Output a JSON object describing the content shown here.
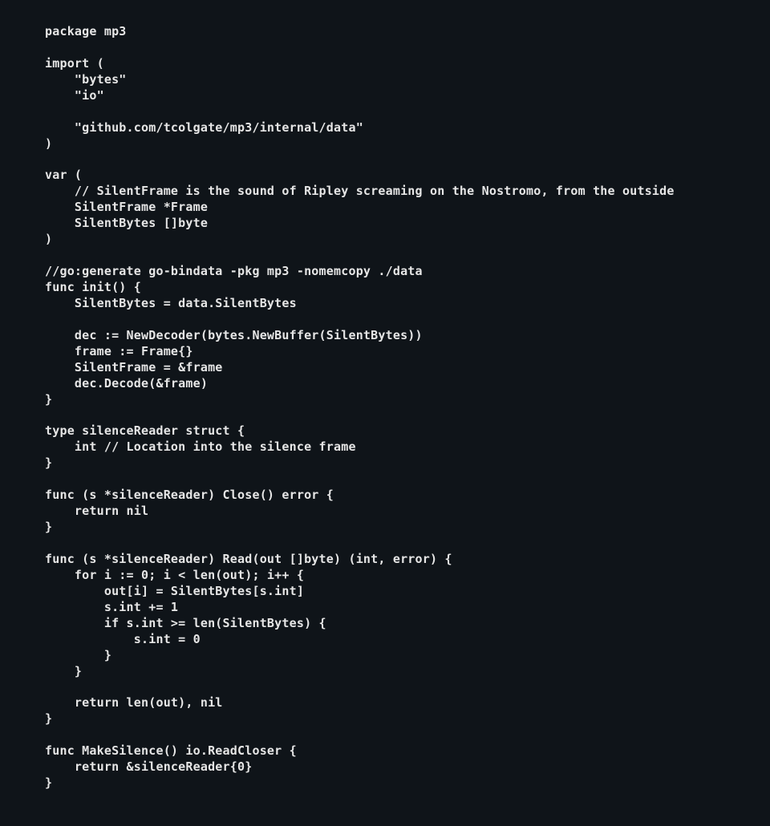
{
  "code": "package mp3\n\nimport (\n    \"bytes\"\n    \"io\"\n\n    \"github.com/tcolgate/mp3/internal/data\"\n)\n\nvar (\n    // SilentFrame is the sound of Ripley screaming on the Nostromo, from the outside\n    SilentFrame *Frame\n    SilentBytes []byte\n)\n\n//go:generate go-bindata -pkg mp3 -nomemcopy ./data\nfunc init() {\n    SilentBytes = data.SilentBytes\n\n    dec := NewDecoder(bytes.NewBuffer(SilentBytes))\n    frame := Frame{}\n    SilentFrame = &frame\n    dec.Decode(&frame)\n}\n\ntype silenceReader struct {\n    int // Location into the silence frame\n}\n\nfunc (s *silenceReader) Close() error {\n    return nil\n}\n\nfunc (s *silenceReader) Read(out []byte) (int, error) {\n    for i := 0; i < len(out); i++ {\n        out[i] = SilentBytes[s.int]\n        s.int += 1\n        if s.int >= len(SilentBytes) {\n            s.int = 0\n        }\n    }\n\n    return len(out), nil\n}\n\nfunc MakeSilence() io.ReadCloser {\n    return &silenceReader{0}\n}"
}
